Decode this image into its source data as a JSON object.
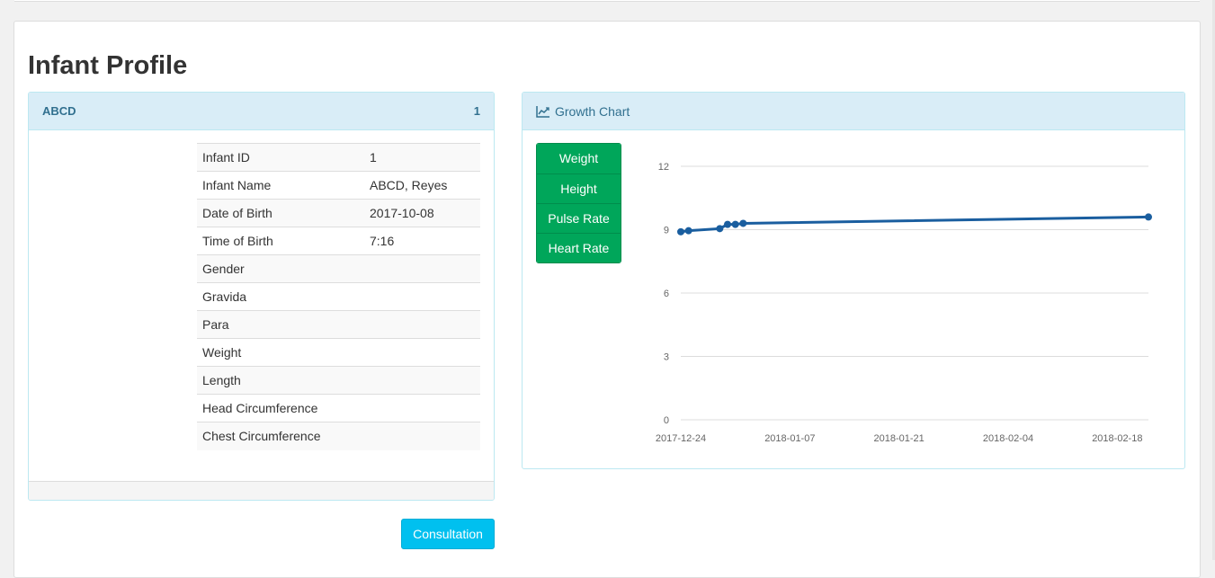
{
  "page": {
    "title": "Infant Profile"
  },
  "profile": {
    "name": "ABCD",
    "id_badge": "1",
    "rows": [
      {
        "label": "Infant ID",
        "value": "1"
      },
      {
        "label": "Infant Name",
        "value": "ABCD, Reyes"
      },
      {
        "label": "Date of Birth",
        "value": "2017-10-08"
      },
      {
        "label": "Time of Birth",
        "value": "7:16"
      },
      {
        "label": "Gender",
        "value": ""
      },
      {
        "label": "Gravida",
        "value": ""
      },
      {
        "label": "Para",
        "value": ""
      },
      {
        "label": "Weight",
        "value": ""
      },
      {
        "label": "Length",
        "value": ""
      },
      {
        "label": "Head Circumference",
        "value": ""
      },
      {
        "label": "Chest Circumference",
        "value": ""
      }
    ]
  },
  "growth": {
    "title": "Growth Chart",
    "icon": "line-chart-icon",
    "buttons": [
      "Weight",
      "Height",
      "Pulse Rate",
      "Heart Rate"
    ]
  },
  "actions": {
    "consultation": "Consultation"
  },
  "colors": {
    "accent_green": "#00a65a",
    "info_blue": "#00c0ef",
    "panel_heading": "#d9edf7",
    "series_line": "#1a5e9f"
  },
  "chart_data": {
    "type": "line",
    "x_tick_labels": [
      "2017-12-24",
      "2018-01-07",
      "2018-01-21",
      "2018-02-04",
      "2018-02-18"
    ],
    "y_ticks": [
      0,
      3,
      6,
      9,
      12
    ],
    "ylim": [
      0,
      12
    ],
    "xlim": [
      "2017-12-24",
      "2018-02-22"
    ],
    "grid": true,
    "series": [
      {
        "x": [
          "2017-12-24",
          "2017-12-25",
          "2017-12-29",
          "2017-12-30",
          "2017-12-31",
          "2018-01-01",
          "2018-02-22"
        ],
        "values": [
          8.9,
          8.95,
          9.05,
          9.25,
          9.25,
          9.3,
          9.6
        ]
      }
    ]
  }
}
